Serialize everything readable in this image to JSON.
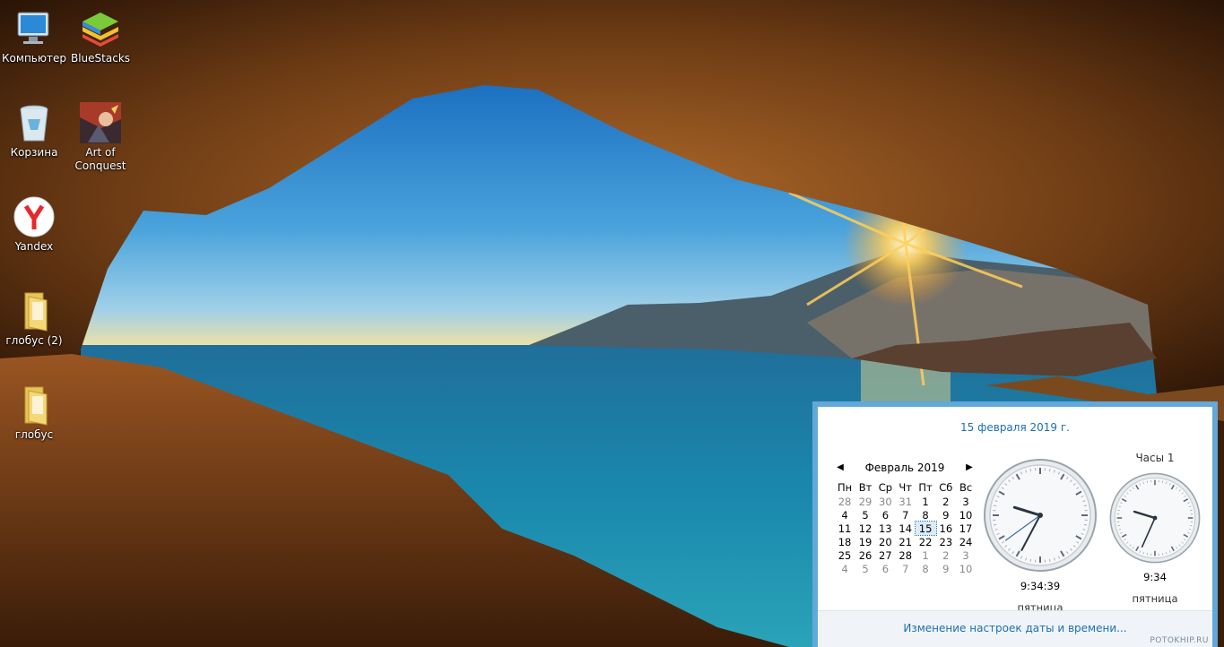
{
  "desktop": {
    "icons": [
      {
        "label": "Компьютер",
        "icon": "computer-icon"
      },
      {
        "label": "BlueStacks",
        "icon": "bluestacks-icon"
      },
      {
        "label": "Корзина",
        "icon": "recycle-bin-icon"
      },
      {
        "label": "Art of Conquest",
        "icon": "game-icon"
      },
      {
        "label": "Yandex",
        "icon": "yandex-browser-icon"
      },
      {
        "label": "глобус (2)",
        "icon": "folder-icon"
      },
      {
        "label": "глобус",
        "icon": "folder-icon"
      }
    ]
  },
  "flyout": {
    "date_link": "15 февраля 2019 г.",
    "calendar": {
      "month_title": "Февраль 2019",
      "weekdays": [
        "Пн",
        "Вт",
        "Ср",
        "Чт",
        "Пт",
        "Сб",
        "Вс"
      ],
      "weeks": [
        [
          "28",
          "29",
          "30",
          "31",
          "1",
          "2",
          "3"
        ],
        [
          "4",
          "5",
          "6",
          "7",
          "8",
          "9",
          "10"
        ],
        [
          "11",
          "12",
          "13",
          "14",
          "15",
          "16",
          "17"
        ],
        [
          "18",
          "19",
          "20",
          "21",
          "22",
          "23",
          "24"
        ],
        [
          "25",
          "26",
          "27",
          "28",
          "1",
          "2",
          "3"
        ],
        [
          "4",
          "5",
          "6",
          "7",
          "8",
          "9",
          "10"
        ]
      ],
      "today": "15"
    },
    "clocks": [
      {
        "name": "",
        "time": "9:34:39",
        "day": "пятница",
        "hour": 9,
        "minute": 34,
        "second": 39
      },
      {
        "name": "Часы 1",
        "time": "9:34",
        "day": "пятница",
        "hour": 9,
        "minute": 34,
        "second": null
      }
    ],
    "footer_link": "Изменение настроек даты и времени...",
    "watermark": "POTOKHIP.RU"
  },
  "colors": {
    "accent": "#1c6fb5",
    "flyout_border": "#62a8d8"
  }
}
